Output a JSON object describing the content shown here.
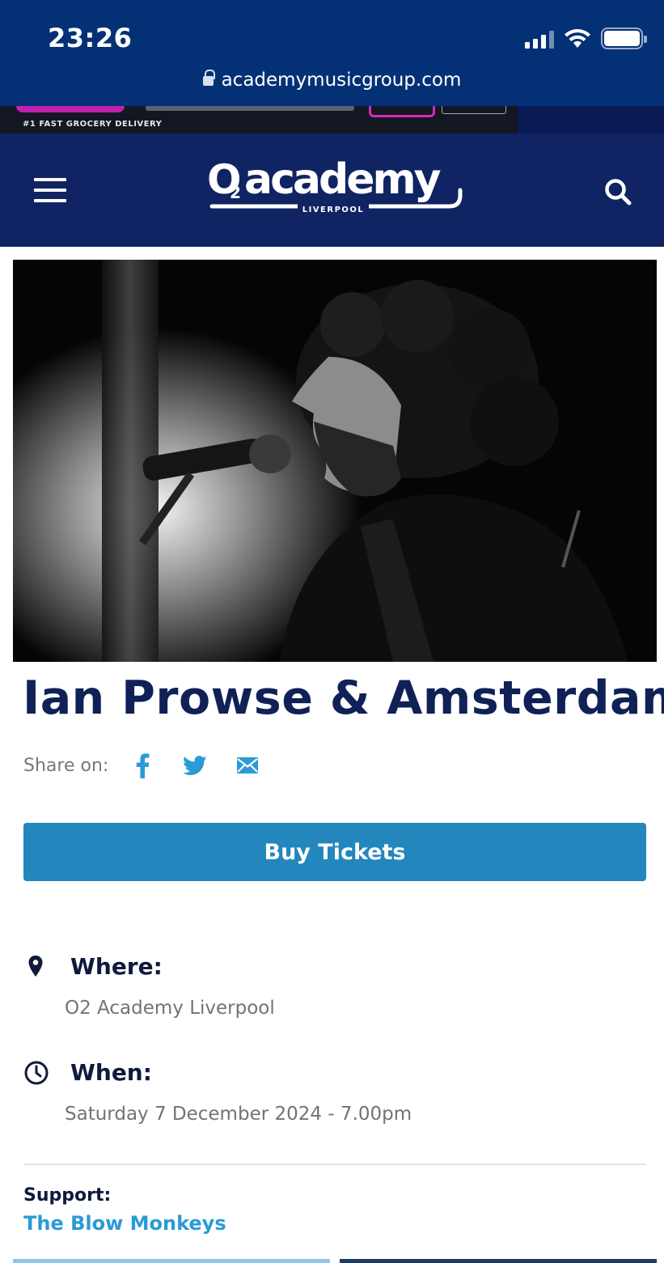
{
  "status_bar": {
    "time": "23:26",
    "url": "academymusicgroup.com"
  },
  "ad": {
    "tagline": "#1 FAST GROCERY DELIVERY"
  },
  "header": {
    "logo_text": "O2academy",
    "logo_sub": "LIVERPOOL",
    "menu_icon": "hamburger-menu-icon",
    "search_icon": "search-icon"
  },
  "event": {
    "title": "Ian Prowse & Amsterdam",
    "share_label": "Share on:",
    "share_icons": [
      "facebook-icon",
      "twitter-icon",
      "email-icon"
    ],
    "buy_label": "Buy Tickets",
    "where_label": "Where:",
    "where_value": "O2 Academy Liverpool",
    "when_label": "When:",
    "when_value": "Saturday 7 December 2024 - 7.00pm",
    "support_label": "Support:",
    "support_value": "The Blow Monkeys"
  },
  "colors": {
    "status_bar_bg": "#043176",
    "header_bg": "#102463",
    "title": "#0f2156",
    "button": "#2386bc",
    "link": "#2a9bd6"
  }
}
